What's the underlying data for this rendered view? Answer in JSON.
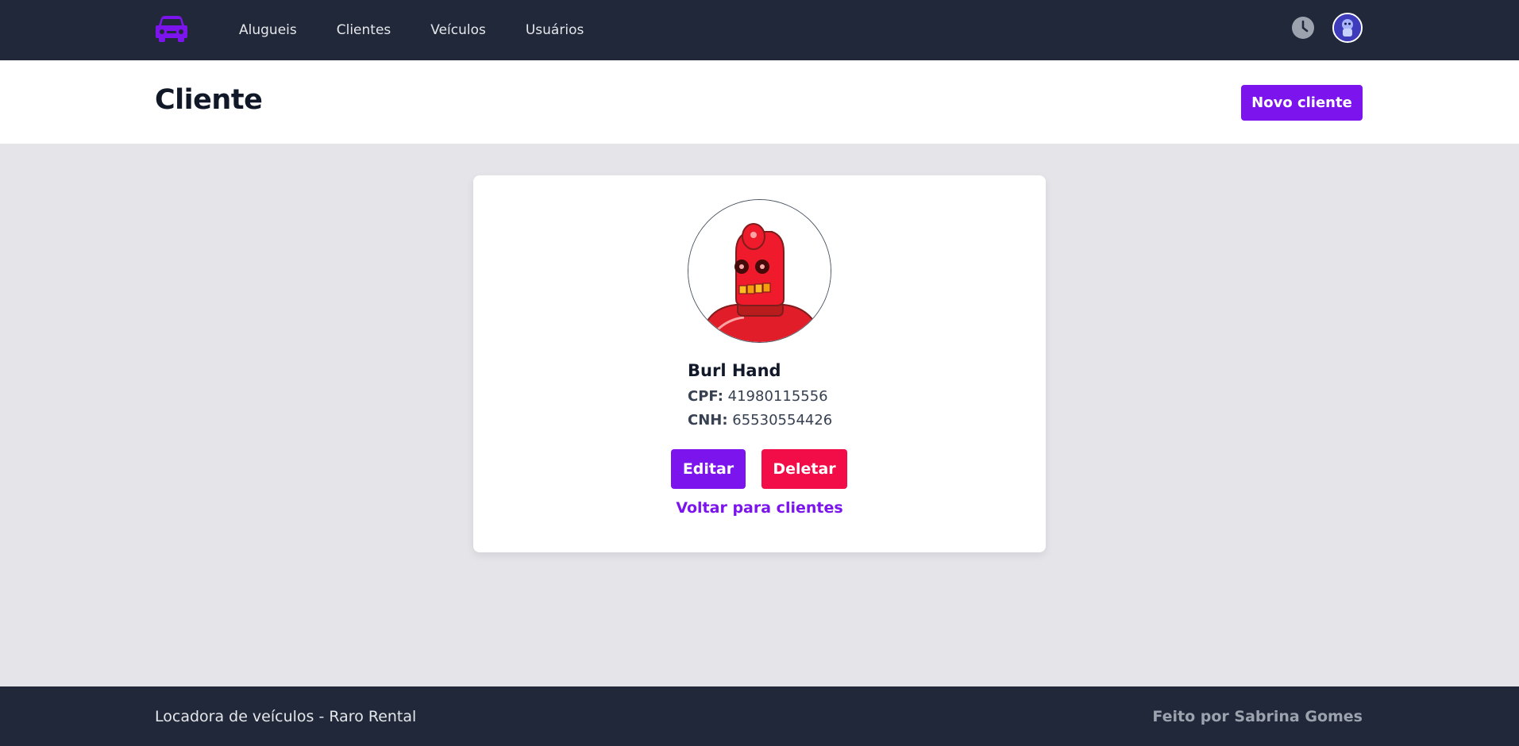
{
  "nav": {
    "links": [
      {
        "label": "Alugueis"
      },
      {
        "label": "Clientes"
      },
      {
        "label": "Veículos"
      },
      {
        "label": "Usuários"
      }
    ]
  },
  "header": {
    "title": "Cliente",
    "new_button": "Novo cliente"
  },
  "client": {
    "name": "Burl Hand",
    "cpf_label": "CPF:",
    "cpf": "41980115556",
    "cnh_label": "CNH:",
    "cnh": "65530554426"
  },
  "actions": {
    "edit": "Editar",
    "delete": "Deletar",
    "back": "Voltar para clientes"
  },
  "footer": {
    "left": "Locadora de veículos - Raro Rental",
    "right": "Feito por Sabrina Gomes"
  },
  "icons": {
    "logo": "car-icon",
    "history": "clock-icon",
    "profile": "user-avatar"
  },
  "colors": {
    "primary": "#7c14ed",
    "danger": "#f20c48",
    "nav_bg": "#212839",
    "page_bg": "#e4e4e9"
  }
}
